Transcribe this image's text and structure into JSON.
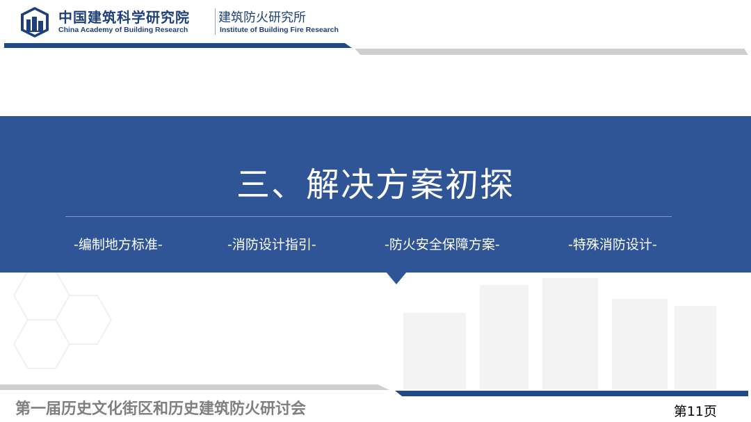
{
  "header": {
    "org_cn": "中国建筑科学研究院",
    "org_en": "China Academy of Building Research",
    "institute_cn": "建筑防火研究所",
    "institute_en": "Institute of Building Fire Research",
    "logo_icon": "cabr-logo-icon"
  },
  "slide": {
    "title": "三、解决方案初探",
    "items": [
      "-编制地方标准-",
      "-消防设计指引-",
      "-防火安全保障方案-",
      "-特殊消防设计-"
    ]
  },
  "footer": {
    "event": "第一届历史文化街区和历史建筑防火研讨会",
    "page": "第11页"
  },
  "colors": {
    "brand_blue": "#2f5597",
    "dark_blue": "#1f4a86",
    "gray": "#cfcfcf"
  }
}
